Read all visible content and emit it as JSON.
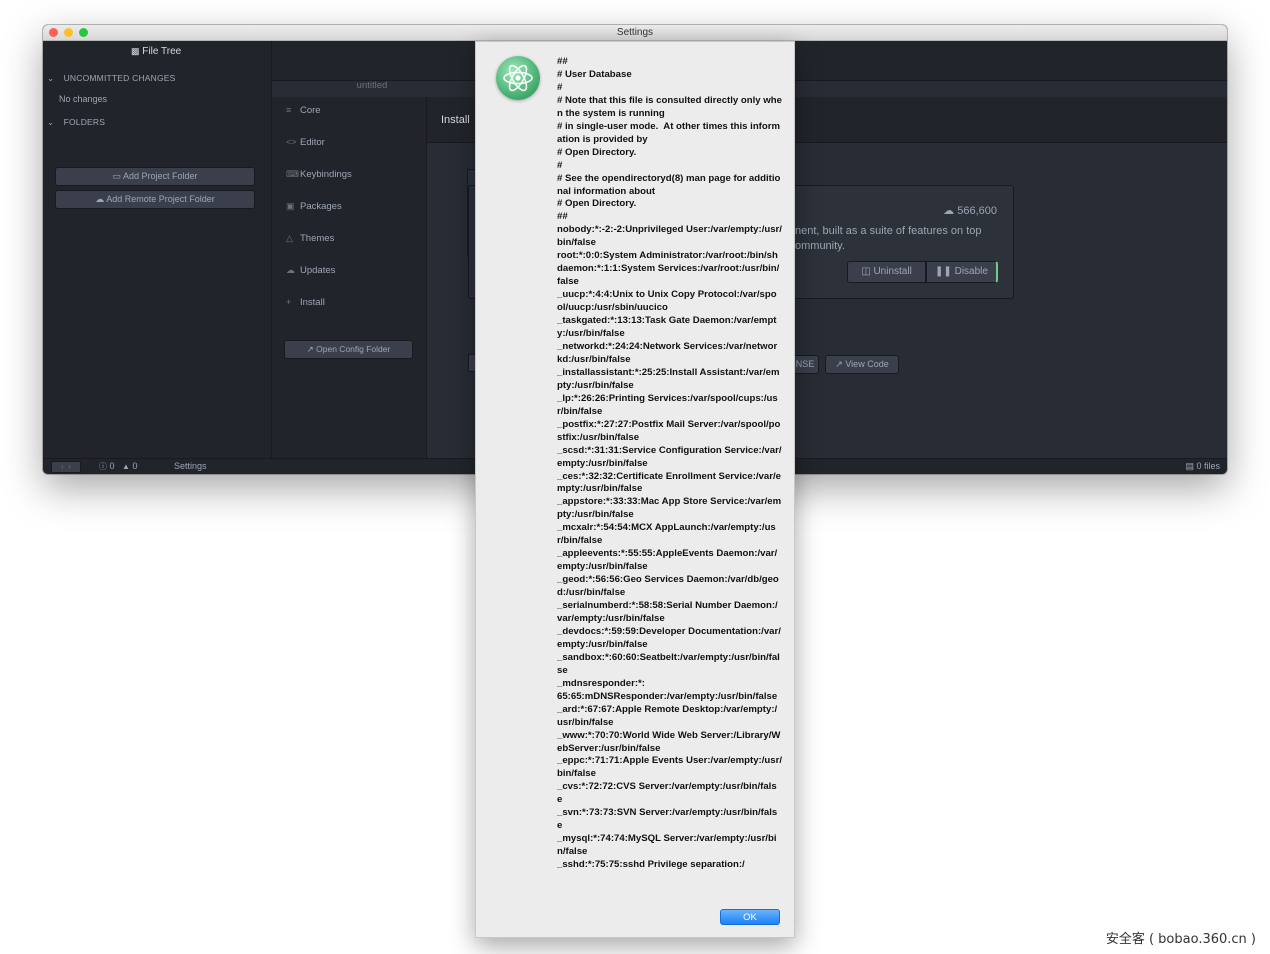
{
  "window": {
    "title": "Settings",
    "traffic_lights": [
      "#fd5f57",
      "#fdbd2f",
      "#27c840"
    ]
  },
  "file_tree": {
    "title": "File Tree",
    "uncommitted_section": "UNCOMMITTED CHANGES",
    "no_changes": "No changes",
    "folders_section": "FOLDERS",
    "add_project_folder": "Add Project Folder",
    "add_remote_project_folder": "Add Remote Project Folder"
  },
  "tabs": {
    "untitled": "untitled"
  },
  "settings_nav": {
    "items": [
      {
        "label": "Core",
        "icon": "sliders-icon",
        "glyph": "⸺"
      },
      {
        "label": "Editor",
        "icon": "code-icon",
        "glyph": "<>"
      },
      {
        "label": "Keybindings",
        "icon": "keyboard-icon",
        "glyph": "⌨"
      },
      {
        "label": "Packages",
        "icon": "package-icon",
        "glyph": "⎕"
      },
      {
        "label": "Themes",
        "icon": "paintcan-icon",
        "glyph": "△"
      },
      {
        "label": "Updates",
        "icon": "cloud-download-icon",
        "glyph": "☁"
      },
      {
        "label": "Install",
        "icon": "plus-icon",
        "glyph": "+"
      }
    ],
    "open_config_folder": "Open Config Folder"
  },
  "install_panel": {
    "title": "Install",
    "package": {
      "downloads": "566,600",
      "description_line1": "nent, built as a suite of features on top",
      "description_line2": "ommunity.",
      "uninstall": "Uninstall",
      "disable": "Disable",
      "license_fragment": "NSE",
      "view_code": "View Code"
    }
  },
  "statusbar": {
    "errors": "0",
    "warnings": "0",
    "tab_label": "Settings",
    "files": "0 files"
  },
  "alert": {
    "message": "##\n# User Database\n#\n# Note that this file is consulted directly only when the system is running\n# in single-user mode.  At other times this information is provided by\n# Open Directory.\n#\n# See the opendirectoryd(8) man page for additional information about\n# Open Directory.\n##\nnobody:*:-2:-2:Unprivileged User:/var/empty:/usr/bin/false\nroot:*:0:0:System Administrator:/var/root:/bin/sh\ndaemon:*:1:1:System Services:/var/root:/usr/bin/false\n_uucp:*:4:4:Unix to Unix Copy Protocol:/var/spool/uucp:/usr/sbin/uucico\n_taskgated:*:13:13:Task Gate Daemon:/var/empty:/usr/bin/false\n_networkd:*:24:24:Network Services:/var/networkd:/usr/bin/false\n_installassistant:*:25:25:Install Assistant:/var/empty:/usr/bin/false\n_lp:*:26:26:Printing Services:/var/spool/cups:/usr/bin/false\n_postfix:*:27:27:Postfix Mail Server:/var/spool/postfix:/usr/bin/false\n_scsd:*:31:31:Service Configuration Service:/var/empty:/usr/bin/false\n_ces:*:32:32:Certificate Enrollment Service:/var/empty:/usr/bin/false\n_appstore:*:33:33:Mac App Store Service:/var/empty:/usr/bin/false\n_mcxalr:*:54:54:MCX AppLaunch:/var/empty:/usr/bin/false\n_appleevents:*:55:55:AppleEvents Daemon:/var/empty:/usr/bin/false\n_geod:*:56:56:Geo Services Daemon:/var/db/geod:/usr/bin/false\n_serialnumberd:*:58:58:Serial Number Daemon:/var/empty:/usr/bin/false\n_devdocs:*:59:59:Developer Documentation:/var/empty:/usr/bin/false\n_sandbox:*:60:60:Seatbelt:/var/empty:/usr/bin/false\n_mdnsresponder:*:\n65:65:mDNSResponder:/var/empty:/usr/bin/false\n_ard:*:67:67:Apple Remote Desktop:/var/empty:/usr/bin/false\n_www:*:70:70:World Wide Web Server:/Library/WebServer:/usr/bin/false\n_eppc:*:71:71:Apple Events User:/var/empty:/usr/bin/false\n_cvs:*:72:72:CVS Server:/var/empty:/usr/bin/false\n_svn:*:73:73:SVN Server:/var/empty:/usr/bin/false\n_mysql:*:74:74:MySQL Server:/var/empty:/usr/bin/false\n_sshd:*:75:75:sshd Privilege separation:/",
    "ok": "OK"
  },
  "watermark": "安全客 ( bobao.360.cn )"
}
